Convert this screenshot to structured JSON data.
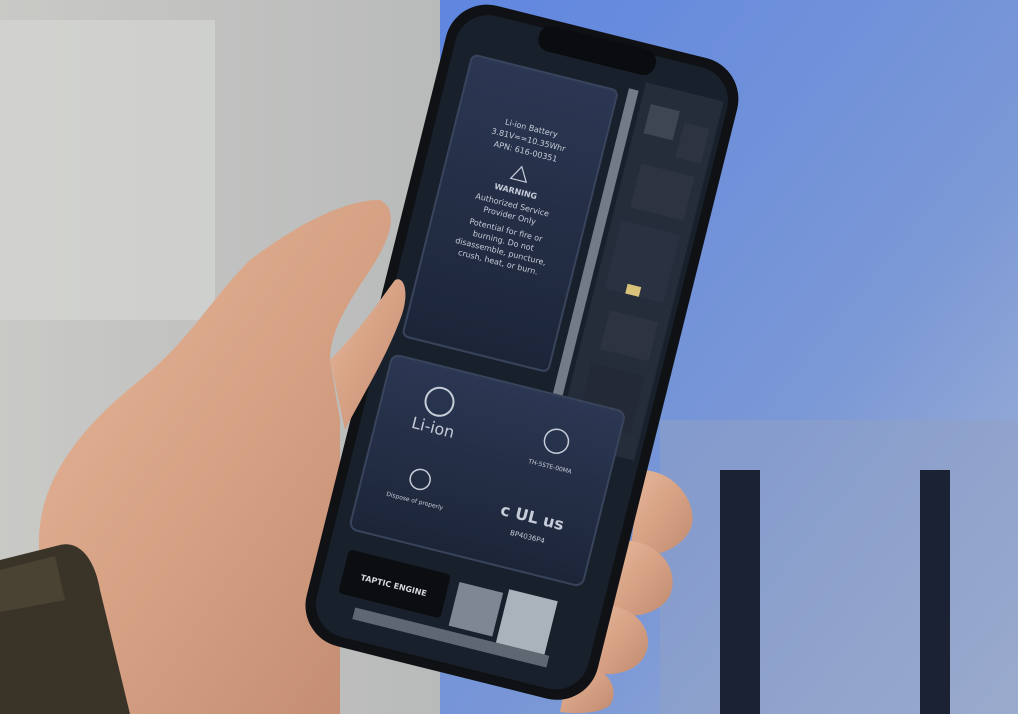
{
  "photo": {
    "subject": "hand holding smartphone with internals wallpaper"
  },
  "battery_top": {
    "lines": [
      "Li-ion Battery",
      "3.81V==10.35Whr",
      "APN: 616-00351",
      "WARNING",
      "Authorized Service",
      "Provider Only",
      "Potential for fire or",
      "burning. Do not",
      "disassemble, puncture,",
      "crush, heat, or burn."
    ]
  },
  "battery_bottom": {
    "li_ion": "Li-ion",
    "recycle_icon": "recycle-icon",
    "ul_mark": "c UL us",
    "ul_code": "BP4036P4",
    "cert_text": "TH-5STE-00MA",
    "dispose_text": "Dispose of properly"
  },
  "taptic": {
    "label": "TAPTIC ENGINE"
  },
  "colors": {
    "background_left": "#b9bab8",
    "background_right": "#6e8fd6",
    "phone_frame": "#111316",
    "battery": "#1f2a3f",
    "skin": "#d9a88b",
    "watch_band": "#3a3428"
  }
}
